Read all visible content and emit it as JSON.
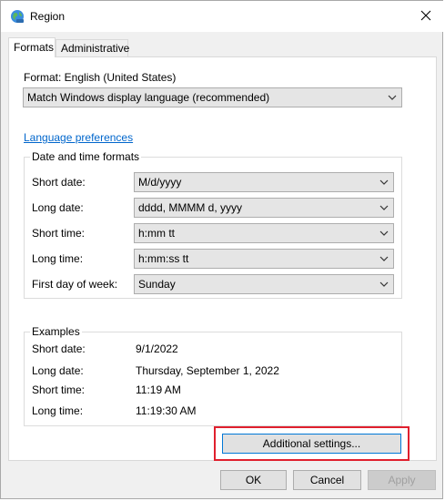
{
  "window": {
    "title": "Region",
    "icon": "region-globe-icon"
  },
  "tabs": [
    {
      "label": "Formats",
      "active": true
    },
    {
      "label": "Administrative",
      "active": false
    }
  ],
  "format": {
    "label": "Format: English (United States)",
    "selected": "Match Windows display language (recommended)"
  },
  "language_link": "Language preferences",
  "datetime": {
    "title": "Date and time formats",
    "rows": [
      {
        "label": "Short date:",
        "value": "M/d/yyyy"
      },
      {
        "label": "Long date:",
        "value": "dddd, MMMM d, yyyy"
      },
      {
        "label": "Short time:",
        "value": "h:mm tt"
      },
      {
        "label": "Long time:",
        "value": "h:mm:ss tt"
      },
      {
        "label": "First day of week:",
        "value": "Sunday"
      }
    ]
  },
  "examples": {
    "title": "Examples",
    "rows": [
      {
        "label": "Short date:",
        "value": "9/1/2022"
      },
      {
        "label": "Long date:",
        "value": "Thursday, September 1, 2022"
      },
      {
        "label": "Short time:",
        "value": "11:19 AM"
      },
      {
        "label": "Long time:",
        "value": "11:19:30 AM"
      }
    ]
  },
  "buttons": {
    "additional": "Additional settings...",
    "ok": "OK",
    "cancel": "Cancel",
    "apply": "Apply"
  },
  "colors": {
    "highlight": "#e0202e",
    "link": "#0066cc",
    "primary_border": "#0078d7"
  }
}
